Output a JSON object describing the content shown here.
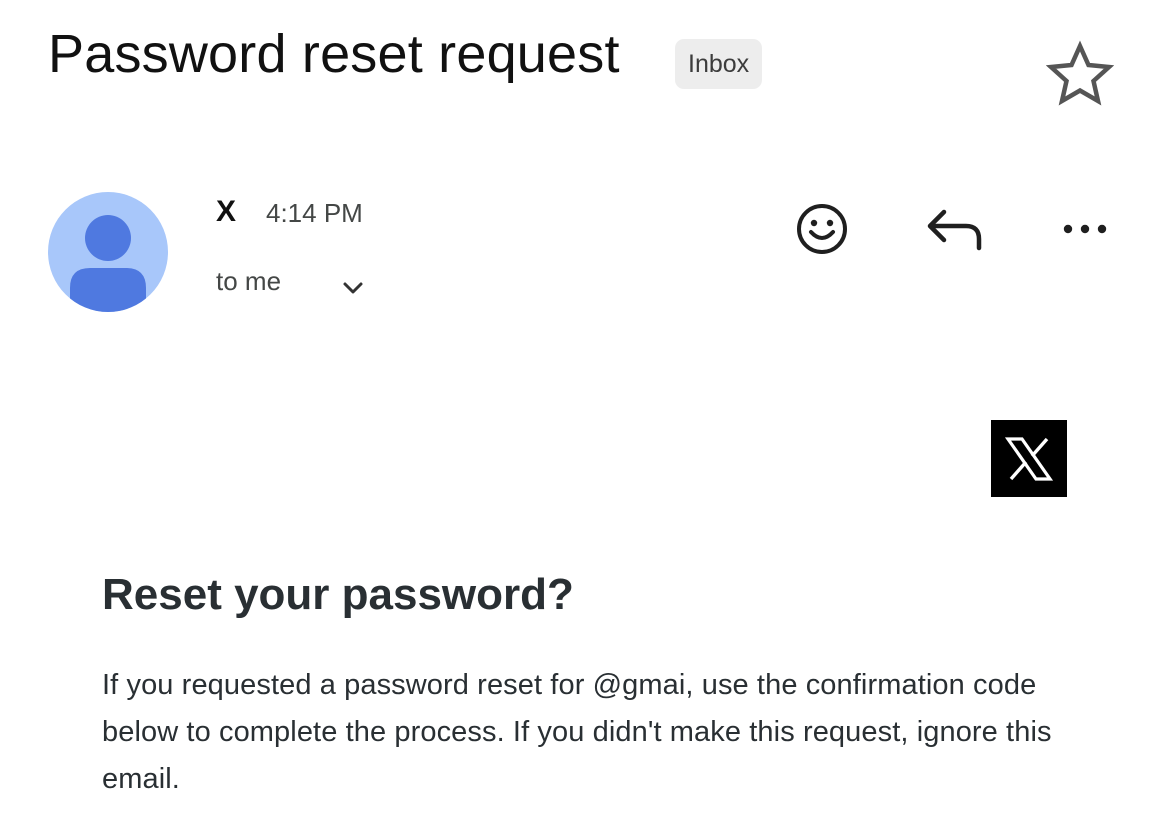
{
  "email": {
    "subject": "Password reset request",
    "label": "Inbox",
    "star_icon": "star-outline-icon"
  },
  "message": {
    "sender_name": "X",
    "time": "4:14 PM",
    "recipient": "to me",
    "avatar_icon": "person-avatar-icon",
    "actions": {
      "emoji_icon": "smiley-icon",
      "reply_icon": "reply-icon",
      "more_icon": "more-horizontal-icon"
    }
  },
  "body": {
    "brand_logo": "x-logo",
    "heading": "Reset your password?",
    "paragraph": "If you requested a password reset for @gmai, use the confirmation code below to complete the process. If you didn't make this request, ignore this email."
  },
  "colors": {
    "avatar_bg": "#a8c7fa",
    "avatar_fg": "#4f79e0",
    "badge_bg": "#ededed",
    "logo_bg": "#000000"
  }
}
